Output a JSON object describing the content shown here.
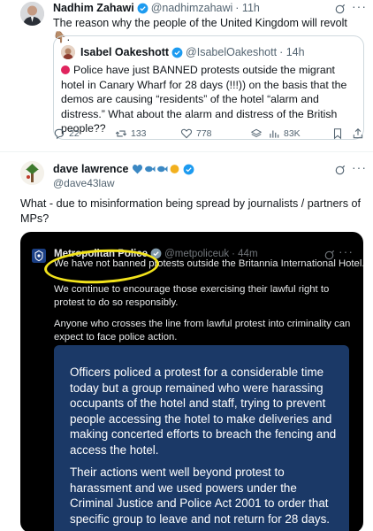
{
  "tweet1": {
    "name": "Nadhim Zahawi",
    "handle": "@nadhimzahawi",
    "time": "· 11h",
    "text": "The reason why the people of the United Kingdom will revolt 👇🏽.",
    "quote": {
      "name": "Isabel Oakeshott",
      "handle": "@IsabelOakeshott",
      "time": "· 14h",
      "text": "Police have just BANNED protests outside the migrant hotel in Canary Wharf for 28 days (!!!)) on the basis that the demos are causing “residents” of the hotel “alarm and distress.”  What about the alarm and distress of the British people??"
    },
    "actions": {
      "replies": "22",
      "reposts": "133",
      "likes": "778",
      "views": "83K"
    }
  },
  "tweet2": {
    "name": "dave lawrence",
    "handle": "@dave43law",
    "text": "What - due to misinformation being spread by journalists / partners of MPs?",
    "media": {
      "name": "Metropolitan Police",
      "handle": "@metpoliceuk",
      "time": "· 44m",
      "line1": "We have not banned protests outside the Britannia International Hotel.",
      "para2": "We continue to encourage those exercising their lawful right to protest to do so responsibly.",
      "para3": "Anyone who crosses the line from lawful protest into criminality can expect to face police action.",
      "statement1": "Officers policed a protest for a considerable time today but a group remained who were harassing occupants of the hotel and staff, trying to prevent people accessing the hotel to make deliveries and making concerted efforts to breach the fencing and access the hotel.",
      "statement2": "Their actions went well beyond protest to harassment and we used powers under the Criminal Justice and Police Act 2001 to order that specific group to leave and not return for 28 days."
    }
  },
  "colors": {
    "verified": "#1d9bf0",
    "text": "#0f1419",
    "secondary": "#536471",
    "statement_bg": "#1b3967",
    "highlight": "#f2e31b"
  },
  "icons": {
    "reply": "reply-icon",
    "repost": "repost-icon",
    "like": "heart-icon",
    "views": "views-icon",
    "bookmark": "bookmark-icon",
    "share": "share-icon",
    "grok": "grok-icon",
    "more": "more-icon"
  }
}
